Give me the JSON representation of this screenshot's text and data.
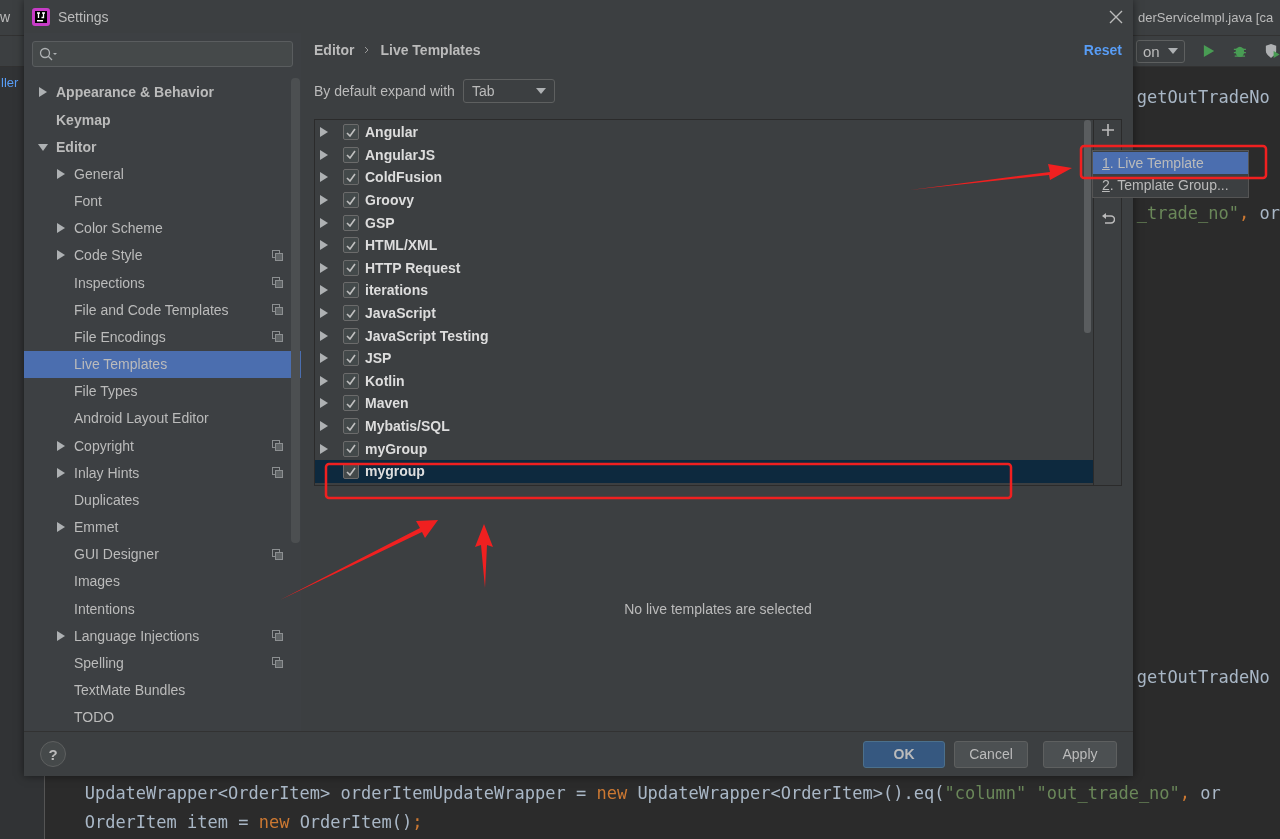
{
  "ide": {
    "left_fragments": [
      "w",
      "ller"
    ],
    "tab_title": "derServiceImpl.java [ca",
    "run_config": "on",
    "right_lines": [
      [
        {
          "text": "getOutTradeNo",
          "kind": "plain"
        }
      ],
      [
        {
          "text": "_trade_no\"",
          "kind": "string"
        },
        {
          "text": ", ",
          "kind": "keyword"
        },
        {
          "text": "or",
          "kind": "plain"
        }
      ],
      [
        {
          "text": "getOutTradeNo",
          "kind": "plain"
        }
      ]
    ],
    "bottom_lines": [
      [
        {
          "text": "UpdateWrapper<OrderItem> orderItemUpdateWrapper = ",
          "kind": "plain"
        },
        {
          "text": "new ",
          "kind": "keyword"
        },
        {
          "text": "UpdateWrapper<OrderItem>().eq(",
          "kind": "plain"
        },
        {
          "text": "\"column\" \"out_trade_no\"",
          "kind": "string"
        },
        {
          "text": ", ",
          "kind": "keyword"
        },
        {
          "text": "or",
          "kind": "plain"
        }
      ],
      [
        {
          "text": "OrderItem item = ",
          "kind": "plain"
        },
        {
          "text": "new ",
          "kind": "keyword"
        },
        {
          "text": "OrderItem()",
          "kind": "plain"
        },
        {
          "text": ";",
          "kind": "keyword"
        }
      ]
    ]
  },
  "window": {
    "title": "Settings"
  },
  "sidebar": {
    "items": [
      {
        "label": "Appearance & Behavior",
        "expanded": false,
        "selected": false
      },
      {
        "label": "Keymap",
        "selected": false
      },
      {
        "label": "Editor",
        "expanded": true,
        "selected": false,
        "children": [
          {
            "label": "General",
            "expanded": false,
            "project_scoped": false,
            "selected": false
          },
          {
            "label": "Font",
            "project_scoped": false,
            "selected": false
          },
          {
            "label": "Color Scheme",
            "expanded": false,
            "project_scoped": false,
            "selected": false
          },
          {
            "label": "Code Style",
            "expanded": false,
            "project_scoped": true,
            "selected": false
          },
          {
            "label": "Inspections",
            "project_scoped": true,
            "selected": false
          },
          {
            "label": "File and Code Templates",
            "project_scoped": true,
            "selected": false
          },
          {
            "label": "File Encodings",
            "project_scoped": true,
            "selected": false
          },
          {
            "label": "Live Templates",
            "project_scoped": false,
            "selected": true
          },
          {
            "label": "File Types",
            "project_scoped": false,
            "selected": false
          },
          {
            "label": "Android Layout Editor",
            "project_scoped": false,
            "selected": false
          },
          {
            "label": "Copyright",
            "expanded": false,
            "project_scoped": true,
            "selected": false
          },
          {
            "label": "Inlay Hints",
            "expanded": false,
            "project_scoped": true,
            "selected": false
          },
          {
            "label": "Duplicates",
            "project_scoped": false,
            "selected": false
          },
          {
            "label": "Emmet",
            "expanded": false,
            "project_scoped": false,
            "selected": false
          },
          {
            "label": "GUI Designer",
            "project_scoped": true,
            "selected": false
          },
          {
            "label": "Images",
            "project_scoped": false,
            "selected": false
          },
          {
            "label": "Intentions",
            "project_scoped": false,
            "selected": false
          },
          {
            "label": "Language Injections",
            "expanded": false,
            "project_scoped": true,
            "selected": false
          },
          {
            "label": "Spelling",
            "project_scoped": true,
            "selected": false
          },
          {
            "label": "TextMate Bundles",
            "project_scoped": false,
            "selected": false
          },
          {
            "label": "TODO",
            "project_scoped": false,
            "selected": false
          }
        ]
      }
    ]
  },
  "breadcrumb": [
    "Editor",
    "Live Templates"
  ],
  "reset": "Reset",
  "expand_with": {
    "label": "By default expand with",
    "value": "Tab"
  },
  "templates": [
    {
      "label": "Angular",
      "expanded": false,
      "checked": true,
      "selected": false
    },
    {
      "label": "AngularJS",
      "expanded": false,
      "checked": true,
      "selected": false
    },
    {
      "label": "ColdFusion",
      "expanded": false,
      "checked": true,
      "selected": false
    },
    {
      "label": "Groovy",
      "expanded": false,
      "checked": true,
      "selected": false
    },
    {
      "label": "GSP",
      "expanded": false,
      "checked": true,
      "selected": false
    },
    {
      "label": "HTML/XML",
      "expanded": false,
      "checked": true,
      "selected": false
    },
    {
      "label": "HTTP Request",
      "expanded": false,
      "checked": true,
      "selected": false
    },
    {
      "label": "iterations",
      "expanded": false,
      "checked": true,
      "selected": false
    },
    {
      "label": "JavaScript",
      "expanded": false,
      "checked": true,
      "selected": false
    },
    {
      "label": "JavaScript Testing",
      "expanded": false,
      "checked": true,
      "selected": false
    },
    {
      "label": "JSP",
      "expanded": false,
      "checked": true,
      "selected": false
    },
    {
      "label": "Kotlin",
      "expanded": false,
      "checked": true,
      "selected": false
    },
    {
      "label": "Maven",
      "expanded": false,
      "checked": true,
      "selected": false
    },
    {
      "label": "Mybatis/SQL",
      "expanded": false,
      "checked": true,
      "selected": false
    },
    {
      "label": "myGroup",
      "expanded": false,
      "checked": true,
      "selected": false
    },
    {
      "label": "mygroup",
      "checked": true,
      "selected": true
    }
  ],
  "add_menu": [
    {
      "label": "1. Live Template",
      "selected": true
    },
    {
      "label": "2. Template Group...",
      "selected": false
    }
  ],
  "empty_message": "No live templates are selected",
  "help": "?",
  "buttons": [
    {
      "label": "OK",
      "kind": "primary"
    },
    {
      "label": "Cancel",
      "kind": "normal"
    },
    {
      "label": "Apply",
      "kind": "normal"
    }
  ]
}
